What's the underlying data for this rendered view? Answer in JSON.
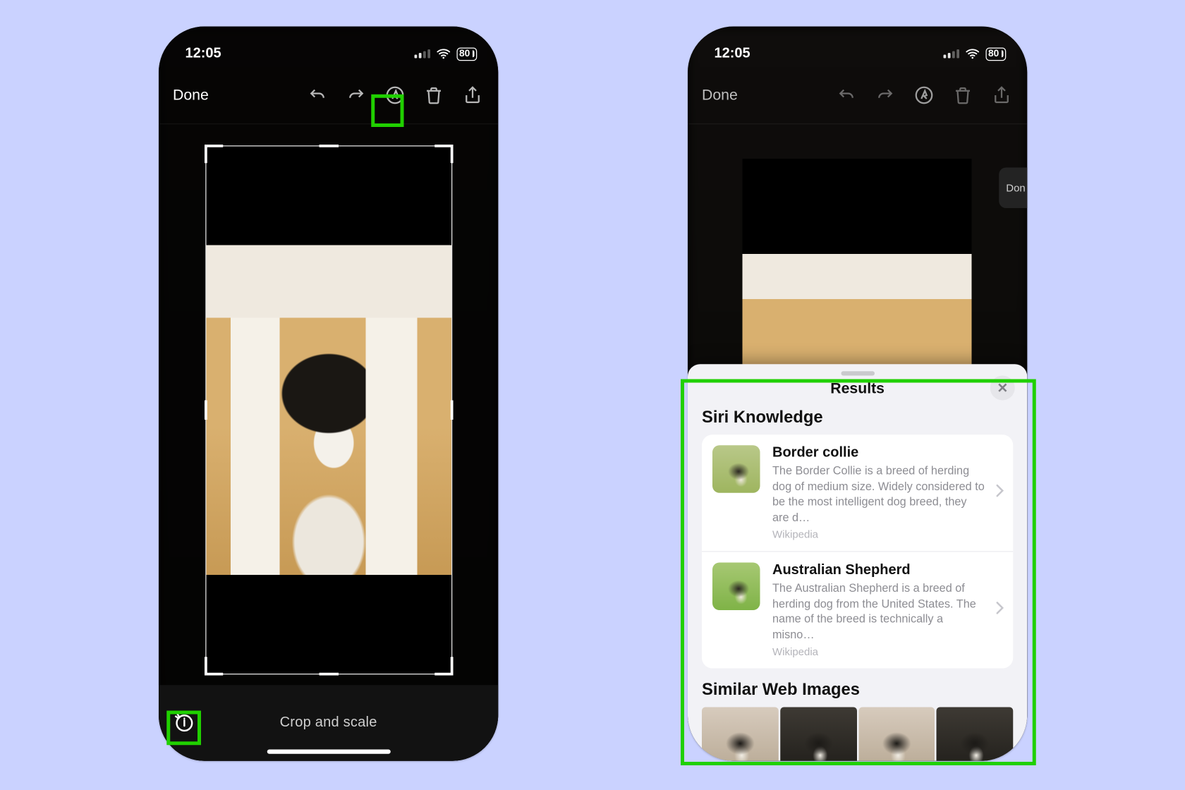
{
  "status": {
    "time": "12:05",
    "battery": "80"
  },
  "toolbar": {
    "done": "Done"
  },
  "bottom": {
    "caption": "Crop and scale"
  },
  "peek": {
    "text": "Don"
  },
  "sheet": {
    "title": "Results",
    "knowledge_header": "Siri Knowledge",
    "similar_header": "Similar Web Images",
    "items": [
      {
        "title": "Border collie",
        "desc": "The Border Collie is a breed of herding dog of medium size. Widely considered to be the most intelligent dog breed, they are d…",
        "source": "Wikipedia"
      },
      {
        "title": "Australian Shepherd",
        "desc": "The Australian Shepherd is a breed of herding dog from the United States. The name of the breed is technically a misno…",
        "source": "Wikipedia"
      }
    ]
  },
  "highlights": {
    "markup_button": true,
    "lookup_button": true,
    "sheet": true
  }
}
